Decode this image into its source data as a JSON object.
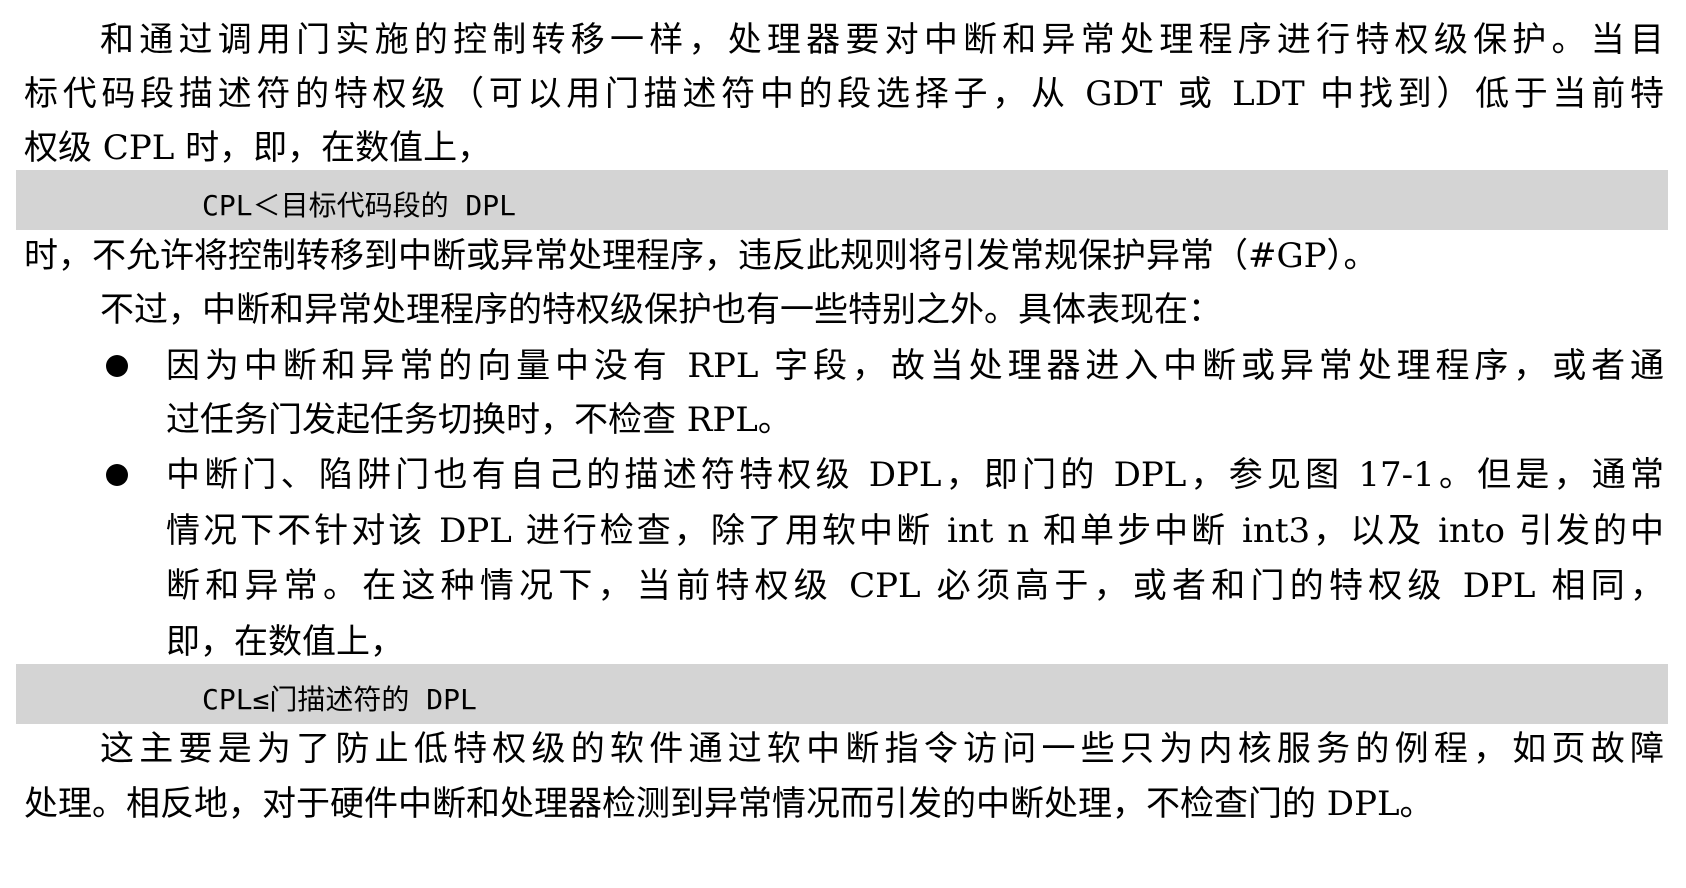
{
  "para1": {
    "line1": "和通过调用门实施的控制转移一样，处理器要对中断和异常处理程序进行特权级保护。当目",
    "line2": "标代码段描述符的特权级（可以用门描述符中的段选择子，从 GDT 或 LDT 中找到）低于当前特",
    "line3": "权级 CPL 时，即，在数值上，"
  },
  "code1": "CPL＜目标代码段的 DPL",
  "para2": {
    "line1": "时，不允许将控制转移到中断或异常处理程序，违反此规则将引发常规保护异常（#GP）。"
  },
  "para3": {
    "line1": "不过，中断和异常处理程序的特权级保护也有一些特别之外。具体表现在："
  },
  "bullets": [
    {
      "lines": [
        "因为中断和异常的向量中没有 RPL 字段，故当处理器进入中断或异常处理程序，或者通",
        "过任务门发起任务切换时，不检查 RPL。"
      ]
    },
    {
      "lines": [
        "中断门、陷阱门也有自己的描述符特权级 DPL，即门的 DPL，参见图 17-1。但是，通常",
        "情况下不针对该 DPL 进行检查，除了用软中断 int n 和单步中断 int3，以及 into 引发的中",
        "断和异常。在这种情况下，当前特权级 CPL 必须高于，或者和门的特权级 DPL 相同，",
        "即，在数值上，"
      ]
    }
  ],
  "code2": "CPL≤门描述符的 DPL",
  "para4": {
    "line1": "这主要是为了防止低特权级的软件通过软中断指令访问一些只为内核服务的例程，如页故障",
    "line2": "处理。相反地，对于硬件中断和处理器检测到异常情况而引发的中断处理，不检查门的 DPL。"
  }
}
